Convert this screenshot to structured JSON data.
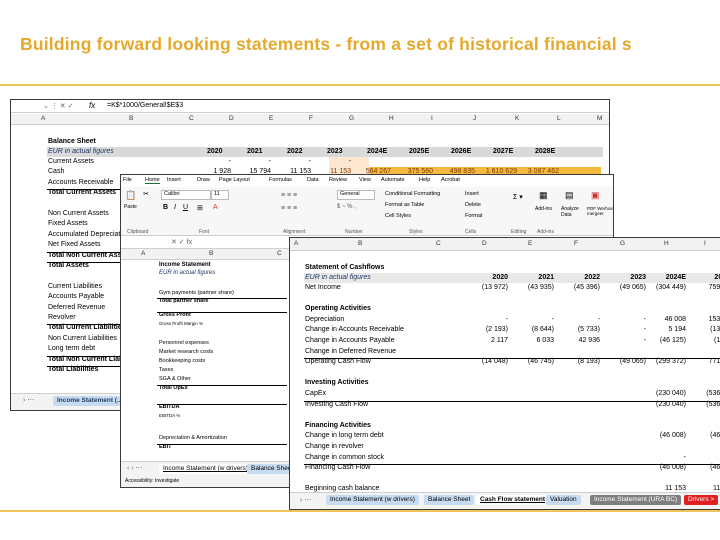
{
  "slide_title": "Building forward looking statements - from a set of historical financial s",
  "balance_sheet_window": {
    "formula": "=K$*1000/General!$E$3",
    "fx": "fx",
    "columns": [
      "A",
      "B",
      "C",
      "D",
      "E",
      "F",
      "G",
      "H",
      "I",
      "J",
      "K",
      "L",
      "M"
    ],
    "title": "Balance Sheet",
    "subtitle": "EUR in actual figures",
    "years": [
      "2020",
      "2021",
      "2022",
      "2023",
      "2024E",
      "2025E",
      "2026E",
      "2027E",
      "2028E"
    ],
    "rows": [
      "Current Assets",
      "Cash",
      "Accounts Receivable",
      "Total Current Assets",
      "",
      "Non Current Assets",
      "Fixed Assets",
      "Accumulated Depreciation",
      "Net Fixed Assets",
      "Total Non Current Assets",
      "Total Assets",
      "",
      "Current Liabilities",
      "Accounts Payable",
      "Deferred Revenue",
      "Revolver",
      "Total Current Liabilities",
      "Non Current Liabilities",
      "Long term debt",
      "Total Non Current Liabilities",
      "Total Liabilities"
    ],
    "current_assets_values": [
      "-",
      "-",
      "-",
      "-"
    ],
    "cash_values": [
      "1 928",
      "15 794",
      "11 153",
      "11 153",
      "564 267",
      "375 560",
      "498 835",
      "1 610 629",
      "3 087 462"
    ],
    "tab": "Income Statement (..."
  },
  "income_window": {
    "menu": [
      "File",
      "Home",
      "Insert",
      "Draw",
      "Page Layout",
      "Formulas",
      "Data",
      "Review",
      "View",
      "Automate",
      "Help",
      "Acrobat"
    ],
    "font": "Calibri",
    "font_size": "11",
    "number_format": "General",
    "ribbon_buttons": [
      "Conditional Formatting",
      "Format as Table",
      "Cell Styles",
      "Insert",
      "Delete",
      "Format",
      "Add-ins",
      "Analyze Data",
      "PDF Werhosula & Nuanciale mergeer"
    ],
    "groups": [
      "Clipboard",
      "Font",
      "Alignment",
      "Number",
      "Styles",
      "Cells",
      "Editing",
      "Add-ins"
    ],
    "columns": [
      "A",
      "B",
      "C"
    ],
    "title": "Income Statement",
    "subtitle": "EUR in actual figures",
    "rows": [
      "Gym payments (partner share)",
      "Total partner share",
      "Gross Profit",
      "Gross Profit Margin %",
      "Personnel expenses",
      "Market research costs",
      "Bookkeeping costs",
      "Taxes",
      "SGA & Other",
      "Total OpEx",
      "EBITDA",
      "EBITDA %",
      "Depreciation & Amortization",
      "EBIT"
    ],
    "tabs": [
      "Income Statement (w drivers)",
      "Balance Sheet"
    ],
    "status": "Accessibility: Investigate"
  },
  "cashflow_window": {
    "columns": [
      "A",
      "B",
      "C",
      "D",
      "E",
      "F",
      "G",
      "H",
      "I"
    ],
    "title": "Statement of Cashflows",
    "subtitle": "EUR in actual figures",
    "years": [
      "2020",
      "2021",
      "2022",
      "2023",
      "2024E",
      "2025"
    ],
    "rows": [
      {
        "label": "Net Income",
        "values": [
          "(13 972)",
          "(43 935)",
          "(45 396)",
          "(49 065)",
          "(304 449)",
          "759 69"
        ]
      },
      {
        "label": "",
        "values": []
      },
      {
        "label": "Operating Activities",
        "bold": true,
        "values": []
      },
      {
        "label": "Depreciation",
        "values": [
          "-",
          "-",
          "-",
          "-",
          "46 008",
          "153 36"
        ]
      },
      {
        "label": "Change in Accounts Receivable",
        "values": [
          "(2 193)",
          "(8 644)",
          "(5 733)",
          "-",
          "5 194",
          "(139 7"
        ]
      },
      {
        "label": "Change in Accounts Payable",
        "values": [
          "2 117",
          "6 033",
          "42 936",
          "-",
          "(46 125)",
          "(1 63"
        ]
      },
      {
        "label": "Change in Deferred Revenue",
        "values": []
      },
      {
        "label": "Operating Cash Flow",
        "total": true,
        "values": [
          "(14 048)",
          "(46 745)",
          "(8 193)",
          "(49 065)",
          "(299 372)",
          "771 44"
        ]
      },
      {
        "label": "",
        "values": []
      },
      {
        "label": "Investing Activities",
        "bold": true,
        "values": []
      },
      {
        "label": "CapEx",
        "values": [
          "",
          "",
          "",
          "",
          "(230 040)",
          "(536 76"
        ]
      },
      {
        "label": "Investing Cash Flow",
        "total": true,
        "values": [
          "",
          "",
          "",
          "",
          "(230 040)",
          "(536 76"
        ]
      },
      {
        "label": "",
        "values": []
      },
      {
        "label": "Financing Activities",
        "bold": true,
        "values": []
      },
      {
        "label": "Change in long term debt",
        "values": [
          "",
          "",
          "",
          "",
          "(46 008)",
          "(46 00"
        ]
      },
      {
        "label": "Change in revolver",
        "values": []
      },
      {
        "label": "Change in common stock",
        "values": [
          "",
          "",
          "",
          "",
          "-",
          "-"
        ]
      },
      {
        "label": "Financing Cash Flow",
        "total": true,
        "values": [
          "",
          "",
          "",
          "",
          "(46 008)",
          "(46 00"
        ]
      },
      {
        "label": "",
        "values": []
      },
      {
        "label": "Beginning cash balance",
        "values": [
          "",
          "",
          "",
          "",
          "11 153",
          "11 15"
        ]
      }
    ],
    "tabs": [
      "Income Statement (w drivers)",
      "Balance Sheet",
      "Cash Flow statement",
      "Valuation",
      "Income Statement (URA BC)",
      "Drivers >"
    ]
  }
}
